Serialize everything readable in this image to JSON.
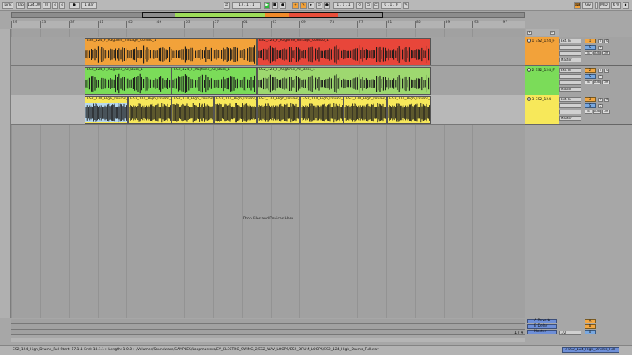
{
  "topbar": {
    "link": "Link",
    "tap": "Tap",
    "tempo": "124.00",
    "tap_buttons": "|||",
    "sig_num": "4",
    "sig_den": "4",
    "metro": "●",
    "quant": "1 Bar",
    "position": "17 .  1 .  1",
    "loop_start": "1 .  1 .  1",
    "loop_len": "0 .  1 .  0",
    "key": "Key",
    "midi": "MIDI",
    "cpu": "6 %"
  },
  "ruler": {
    "labels": [
      "29",
      "33",
      "37",
      "41",
      "45",
      "49",
      "53",
      "57",
      "61",
      "65",
      "69",
      "73",
      "77",
      "81",
      "85",
      "89",
      "93",
      "97"
    ]
  },
  "tracks": [
    {
      "name": "1 ES2_124_F",
      "color": "#f2a23a",
      "input": "Ext. In",
      "in_ch": "1",
      "monitor": "Master",
      "vol": "1",
      "pan": "S",
      "clips": [
        {
          "label": "ES2_124_F_Ragtime_Vintage_Combo_1",
          "color": "#f2a23a"
        },
        {
          "label": "ES2_124_F_Ragtime_Vintage_Combo_1",
          "color": "#e8463a"
        }
      ]
    },
    {
      "name": "2 ES2_124_F",
      "color": "#7bdc59",
      "input": "Ext. In",
      "in_ch": "2",
      "monitor": "Master",
      "vol": "2",
      "pan": "S",
      "clips": [
        {
          "label": "ES2_124_F_Ragtime_Ac_Bass_1",
          "color": "#7bdc59"
        },
        {
          "label": "ES2_124_F_Ragtime_Ac_Bass_1",
          "color": "#7bdc59"
        },
        {
          "label": "ES2_124_F_Ragtime_Ac_Bass_1",
          "color": "#9ed870"
        }
      ]
    },
    {
      "name": "3 ES2_124",
      "color": "#f7e85a",
      "input": "Ext. In",
      "in_ch": "3",
      "monitor": "Master",
      "vol": "3",
      "pan": "S",
      "clips": [
        {
          "label": "ES2_124_High_Drums_Full",
          "color": "#f7e85a"
        },
        {
          "label": "ES2_124_High_Drums_Full",
          "color": "#f7e85a"
        },
        {
          "label": "ES2_124_High_Drums_Full",
          "color": "#f7e85a"
        },
        {
          "label": "ES2_124_High_Drums_Full",
          "color": "#f7e85a"
        },
        {
          "label": "ES2_124_High_Drums_Full",
          "color": "#f7e85a"
        },
        {
          "label": "ES2_124_High_Drums_Full",
          "color": "#f7e85a"
        },
        {
          "label": "ES2_124_High_Drums_Full",
          "color": "#f7e85a"
        },
        {
          "label": "ES2_124_High_Drums_Full",
          "color": "#f7e85a"
        }
      ]
    }
  ],
  "drop_zone": "Drop Files and Devices Here",
  "returns": [
    {
      "name": "A Reverb",
      "vol": "A"
    },
    {
      "name": "B Delay",
      "vol": "B"
    },
    {
      "name": "Master",
      "vol": "1/2"
    }
  ],
  "page_ratio": "1 / 4",
  "status": {
    "text": "ES2_124_High_Drums_Full Start: 17.1.1 End: 18.1.1+ Length: 1.0.0+ /Volumes/Soundware/SAMPLES/Loopmasters/EV_ELECTRO_SWING_2/ES2_WAV_LOOPS/ES2_DRUM_LOOPS/ES2_124_High_Drums_Full.wav",
    "right": "3 ES2_124_High_Drums_Full"
  },
  "colors": {
    "orange": "#f2a23a",
    "red": "#e8463a",
    "green": "#7bdc59",
    "yellow": "#f7e85a",
    "blue_select": "#b6d8ef",
    "return_blue": "#6e8fd8"
  }
}
